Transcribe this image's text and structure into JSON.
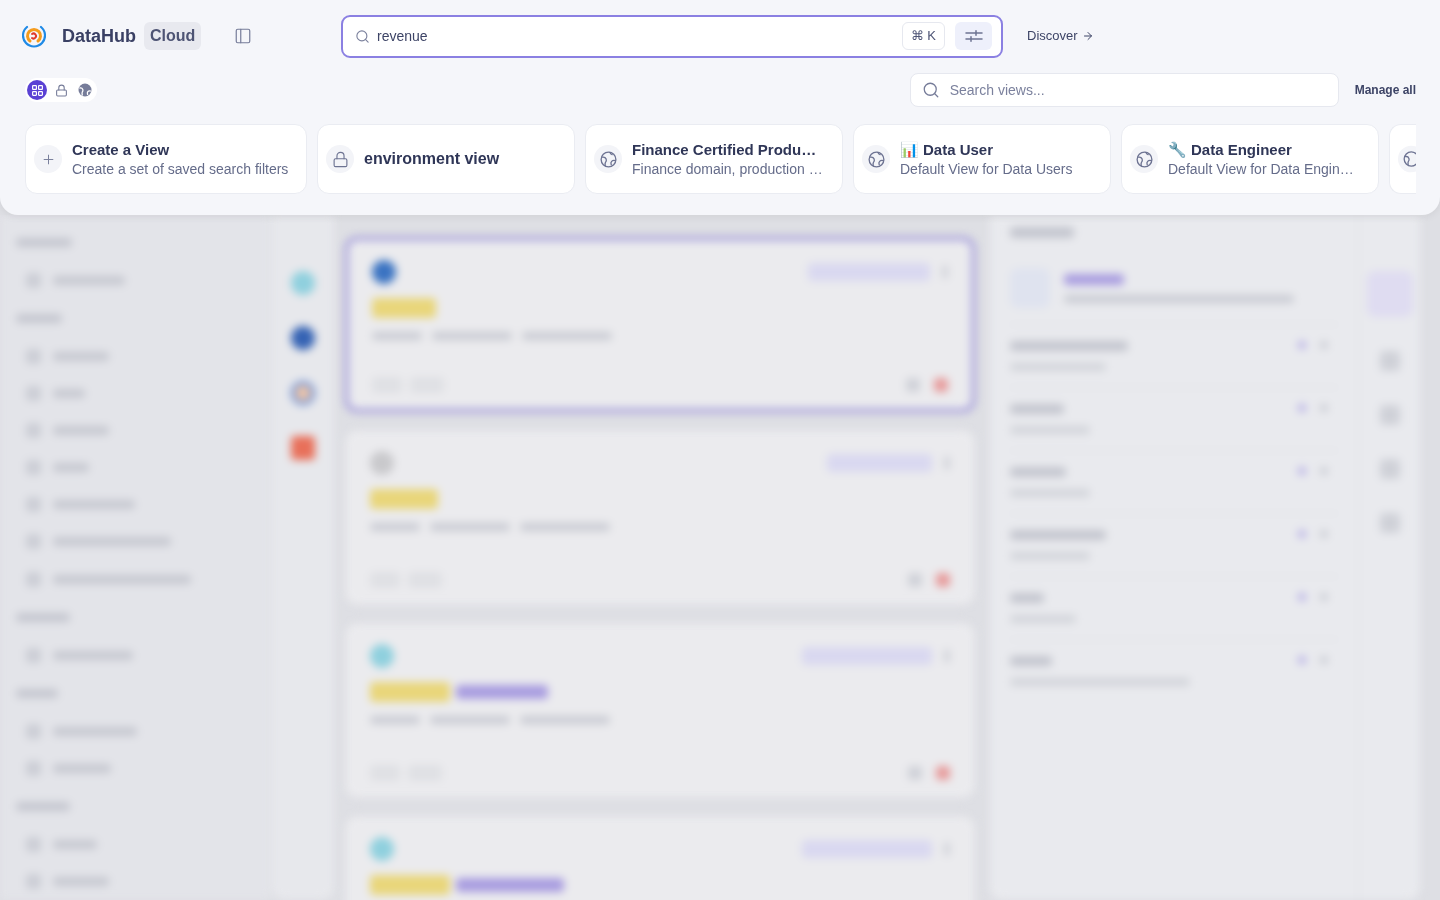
{
  "header": {
    "brand": "DataHub",
    "edition": "Cloud",
    "search": {
      "value": "revenue",
      "shortcut": "⌘ K"
    },
    "discover": "Discover"
  },
  "views_bar": {
    "filters": [
      {
        "kind": "all",
        "selected": true
      },
      {
        "kind": "private",
        "selected": false
      },
      {
        "kind": "public",
        "selected": false
      }
    ],
    "search": {
      "placeholder": "Search views..."
    },
    "manage": "Manage all"
  },
  "views": [
    {
      "kind": "create",
      "title": "Create a View",
      "description": "Create a set of saved search filters",
      "selected": false
    },
    {
      "kind": "private",
      "title": "environment view",
      "selected": false
    },
    {
      "kind": "public",
      "title": "Finance Certified Produ…",
      "description": "Finance domain, production …",
      "selected": false
    },
    {
      "kind": "public",
      "emoji": "📊",
      "title": "Data User",
      "description": "Default View for Data Users",
      "selected": false
    },
    {
      "kind": "public",
      "emoji": "🔧",
      "title": "Data Engineer",
      "description": "Default View for Data Engin…",
      "selected": false
    },
    {
      "kind": "public",
      "selected": false
    }
  ]
}
